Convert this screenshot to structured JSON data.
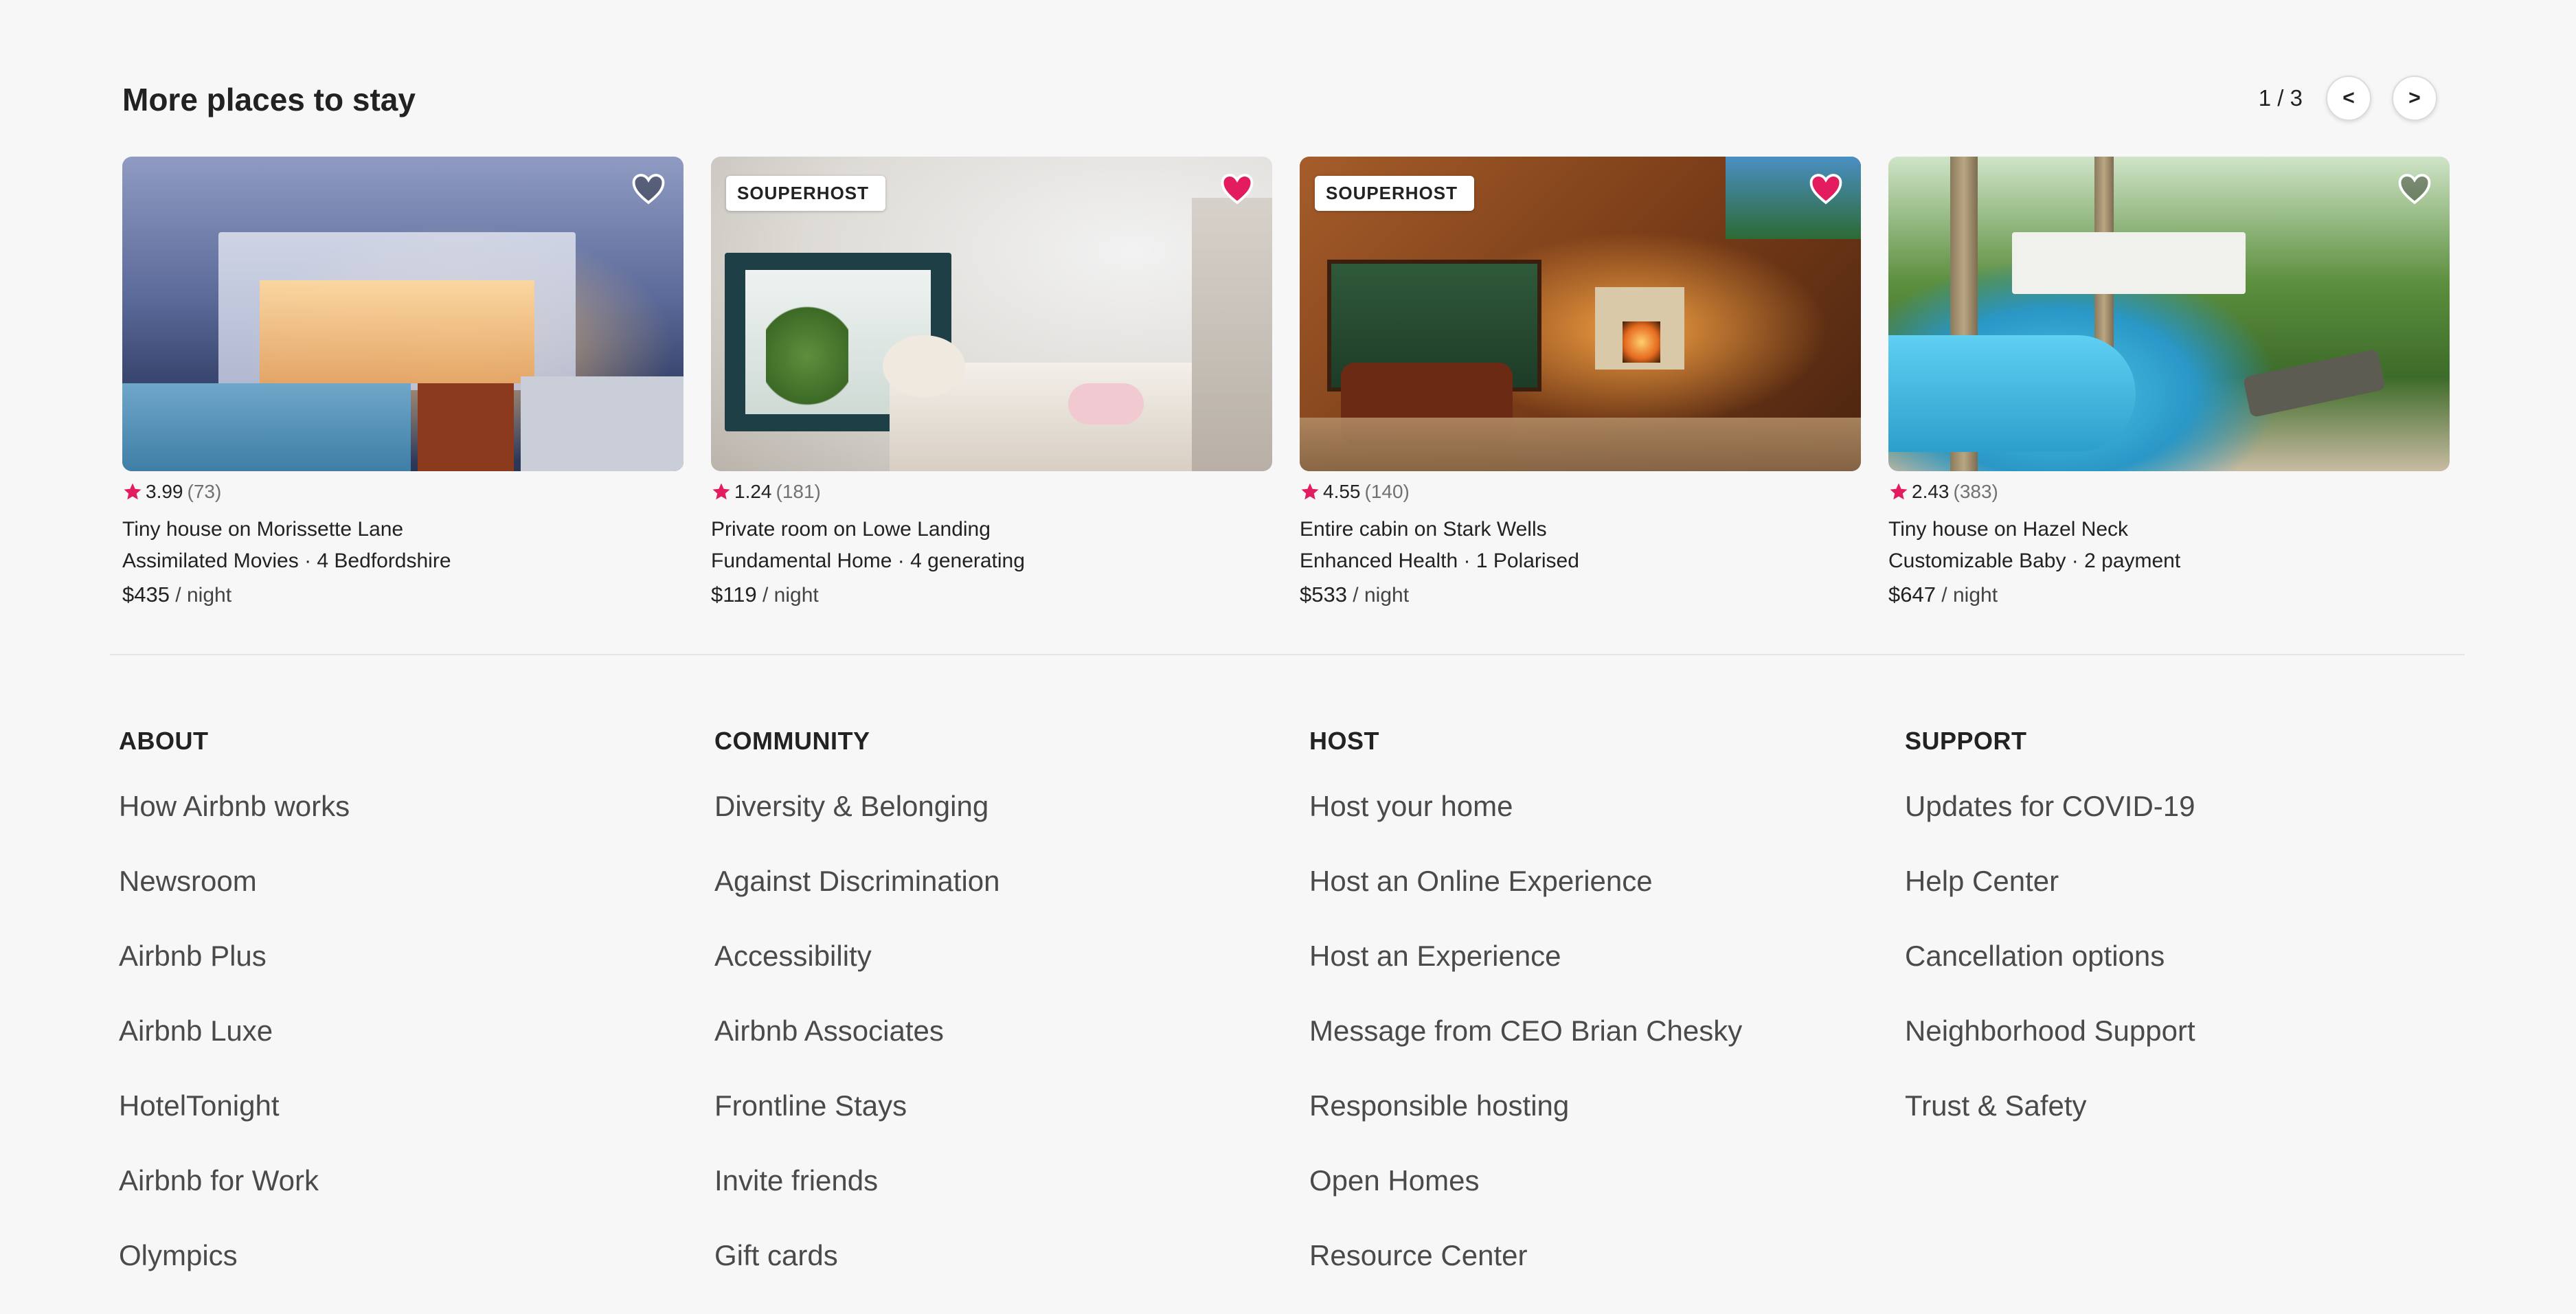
{
  "section": {
    "title": "More places to stay",
    "pager": {
      "text": "1 / 3",
      "prev_label": "<",
      "next_label": ">"
    }
  },
  "listings": [
    {
      "badge": "",
      "favorited": false,
      "rating": "3.99",
      "reviews": "(73)",
      "title": "Tiny house on Morissette Lane",
      "subtitle": "Assimilated Movies · 4 Bedfordshire",
      "price": "$435",
      "per": " / night",
      "image_icon": "villa-photo"
    },
    {
      "badge": "SOUPERHOST",
      "favorited": true,
      "rating": "1.24",
      "reviews": "(181)",
      "title": "Private room on Lowe Landing",
      "subtitle": "Fundamental Home · 4 generating",
      "price": "$119",
      "per": " / night",
      "image_icon": "bedroom-photo"
    },
    {
      "badge": "SOUPERHOST",
      "favorited": true,
      "rating": "4.55",
      "reviews": "(140)",
      "title": "Entire cabin on Stark Wells",
      "subtitle": "Enhanced Health · 1 Polarised",
      "price": "$533",
      "per": " / night",
      "image_icon": "cabin-photo"
    },
    {
      "badge": "",
      "favorited": false,
      "rating": "2.43",
      "reviews": "(383)",
      "title": "Tiny house on Hazel Neck",
      "subtitle": "Customizable Baby · 2 payment",
      "price": "$647",
      "per": " / night",
      "image_icon": "pool-photo"
    }
  ],
  "colors": {
    "brand": "#e31c5f",
    "star": "#e31c5f",
    "heart_fill": "#e31c5f"
  },
  "footer": {
    "columns": [
      {
        "heading": "ABOUT",
        "links": [
          "How Airbnb works",
          "Newsroom",
          "Airbnb Plus",
          "Airbnb Luxe",
          "HotelTonight",
          "Airbnb for Work",
          "Olympics"
        ]
      },
      {
        "heading": "COMMUNITY",
        "links": [
          "Diversity & Belonging",
          "Against Discrimination",
          "Accessibility",
          "Airbnb Associates",
          "Frontline Stays",
          "Invite friends",
          "Gift cards"
        ]
      },
      {
        "heading": "HOST",
        "links": [
          "Host your home",
          "Host an Online Experience",
          "Host an Experience",
          "Message from CEO Brian Chesky",
          "Responsible hosting",
          "Open Homes",
          "Resource Center"
        ]
      },
      {
        "heading": "SUPPORT",
        "links": [
          "Updates for COVID-19",
          "Help Center",
          "Cancellation options",
          "Neighborhood Support",
          "Trust & Safety"
        ]
      }
    ]
  }
}
